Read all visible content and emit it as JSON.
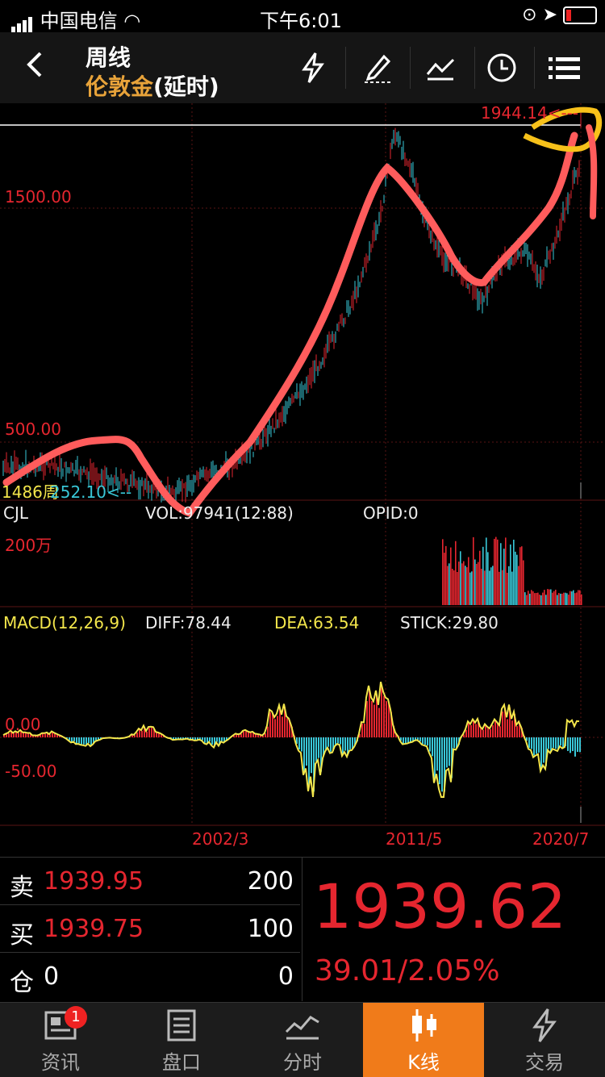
{
  "status": {
    "carrier": "中国电信",
    "time": "下午6:01"
  },
  "header": {
    "back_icon": "chevron-left-icon",
    "period": "周线",
    "instrument": "伦敦金",
    "delay": "(延时)",
    "tools": [
      "lightning-icon",
      "draw-icon",
      "indicator-icon",
      "clock-icon",
      "menu-icon"
    ]
  },
  "chart": {
    "price_high_label": "1944.14<---",
    "price_1500": "1500.00",
    "price_500": "500.00",
    "low_label_left": "1486周",
    "low_label_value": "252.10<--",
    "vol_name": "CJL",
    "vol_value": "VOL:97941(12:88)",
    "opid": "OPID:0",
    "vol_scale": "200万",
    "macd_name": "MACD(12,26,9)",
    "diff": "DIFF:78.44",
    "dea": "DEA:63.54",
    "stick": "STICK:29.80",
    "macd_zero": "0.00",
    "macd_neg": "-50.00",
    "x_labels": [
      "2002/3",
      "2011/5",
      "2020/7"
    ]
  },
  "quote": {
    "sell_label": "卖",
    "sell_price": "1939.95",
    "sell_qty": "200",
    "buy_label": "买",
    "buy_price": "1939.75",
    "buy_qty": "100",
    "pos_label": "仓",
    "pos_value": "0",
    "pos_qty": "0",
    "last_price": "1939.62",
    "change": "39.01/2.05%"
  },
  "tabs": [
    {
      "label": "资讯",
      "icon": "news-icon",
      "badge": "1"
    },
    {
      "label": "盘口",
      "icon": "orderbook-icon"
    },
    {
      "label": "分时",
      "icon": "timeshare-icon"
    },
    {
      "label": "K线",
      "icon": "candlestick-icon",
      "active": true
    },
    {
      "label": "交易",
      "icon": "trade-icon"
    }
  ]
}
